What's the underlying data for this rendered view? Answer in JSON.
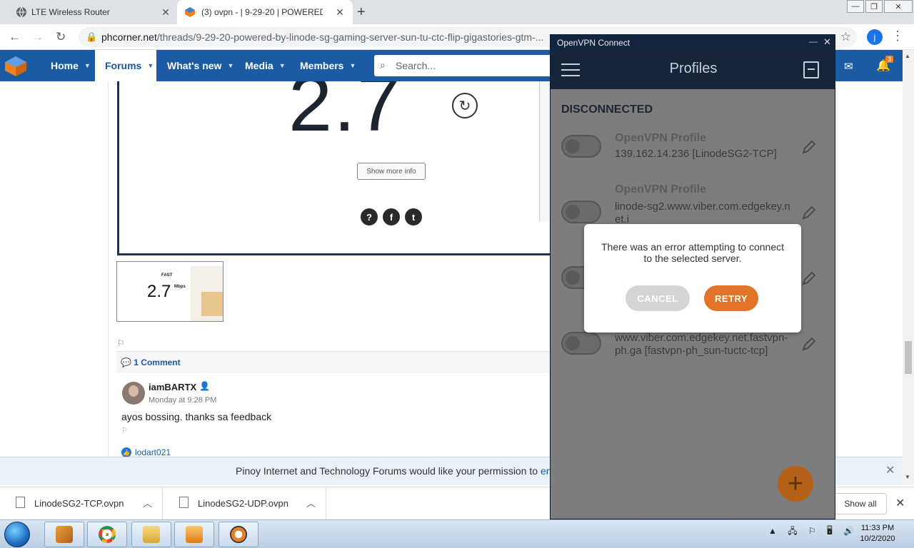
{
  "browser": {
    "tabs": [
      {
        "title": "LTE Wireless Router"
      },
      {
        "title": "(3) ovpn - | 9-29-20 | POWERED E"
      }
    ],
    "new_tab": "+",
    "url_host": "phcorner.net",
    "url_path": "/threads/9-29-20-powered-by-linode-sg-gaming-server-sun-tu-ctc-flip-gigastories-gtm-...",
    "profile_initial": "j",
    "window_controls": {
      "minimize": "—",
      "restore": "❐",
      "close": "✕"
    }
  },
  "forum_nav": {
    "items": [
      "Home",
      "Forums",
      "What's new",
      "Media",
      "Members"
    ],
    "active": "Forums",
    "search_placeholder": "Search...",
    "notification_count": "3"
  },
  "post": {
    "speed_value": "2.7",
    "show_more_label": "Show more info",
    "social_icons": [
      "?",
      "f",
      "t"
    ],
    "thumbnail": {
      "speed": "2.7",
      "unit": "Mbps",
      "brand": "FAST"
    }
  },
  "comments": {
    "header": "1 Comment",
    "items": [
      {
        "author": "iamBARTX",
        "time": "Monday at 9:28 PM",
        "text": "ayos bossing. thanks sa feedback",
        "liked_by": "lodart021"
      }
    ]
  },
  "cookie_banner": {
    "text": "Pinoy Internet and Technology Forums would like your permission to ",
    "link": "en"
  },
  "downloads": {
    "files": [
      "LinodeSG2-TCP.ovpn",
      "LinodeSG2-UDP.ovpn"
    ],
    "show_all_label": "Show all"
  },
  "taskbar": {
    "clock_time": "11:33 PM",
    "clock_date": "10/2/2020"
  },
  "openvpn": {
    "window_title": "OpenVPN Connect",
    "heading": "Profiles",
    "status": "DISCONNECTED",
    "profiles": [
      {
        "name": "OpenVPN Profile",
        "desc": "139.162.14.236 [LinodeSG2-TCP]"
      },
      {
        "name": "OpenVPN Profile",
        "desc": "linode-sg2.www.viber.com.edgekey.net.i"
      },
      {
        "name": "",
        "desc": ""
      },
      {
        "name": "",
        "desc": "www.viber.com.edgekey.net.fastvpn-ph.ga [fastvpn-ph_sun-tuctc-tcp]"
      }
    ],
    "fab_label": "+",
    "dialog": {
      "message": "There was an error attempting to connect to the selected server.",
      "cancel": "CANCEL",
      "retry": "RETRY"
    },
    "colors": {
      "accent": "#e2742a",
      "header": "#17253b"
    }
  }
}
